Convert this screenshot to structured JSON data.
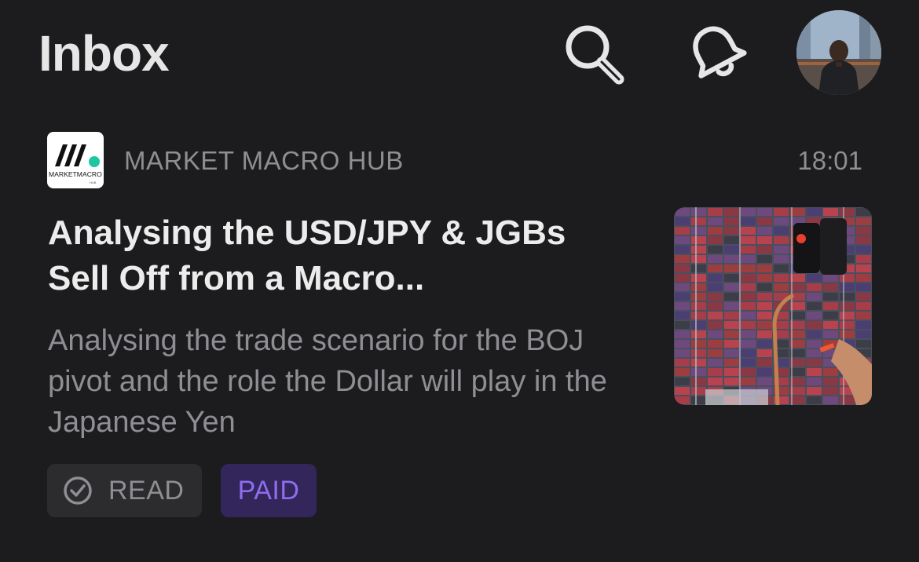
{
  "header": {
    "title": "Inbox",
    "icons": [
      "search-icon",
      "bell-icon"
    ],
    "avatar": "user-avatar"
  },
  "post": {
    "publication": {
      "logo_text": "MARKETMACRO",
      "logo_sub": "HUB",
      "name": "MARKET MACRO HUB"
    },
    "time": "18:01",
    "title": "Analysing the USD/JPY & JGBs Sell Off from a Macro...",
    "subtitle": "Analysing the trade scenario for the BOJ pivot and the role the Dollar will play in the Japanese Yen",
    "badges": {
      "read": "READ",
      "paid": "PAID"
    }
  },
  "colors": {
    "background": "#1c1c1e",
    "secondary_text": "#8e8e93",
    "paid_accent": "#8f6cf0",
    "paid_bg": "#33265a",
    "logo_dot": "#1ec7a4"
  }
}
